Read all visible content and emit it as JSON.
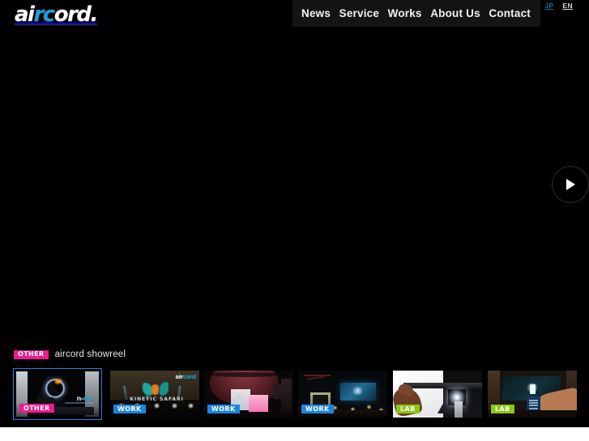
{
  "site": {
    "logo_text_a": "ai",
    "logo_text_b": "rc",
    "logo_text_c": "ord",
    "logo_dot": "."
  },
  "nav": {
    "items": [
      {
        "label": "News"
      },
      {
        "label": "Service"
      },
      {
        "label": "Works"
      },
      {
        "label": "About Us"
      },
      {
        "label": "Contact"
      }
    ]
  },
  "lang": {
    "jp": "JP",
    "en": "EN",
    "jp_color": "#1a6e9e",
    "en_color": "#d8d8d8"
  },
  "hero": {
    "next_button_label": "▶",
    "caption_badge": "OTHER",
    "caption_title": "aircord showreel"
  },
  "colors": {
    "accent_blue": "#1f9fd8",
    "badge_other": "#ec1b8e",
    "badge_work": "#1a86e0",
    "badge_lab": "#8cc713",
    "background": "#000000",
    "footer": "#ffffff"
  },
  "thumbnails": [
    {
      "badge": "OTHER",
      "category": "other",
      "active": true
    },
    {
      "badge": "WORK",
      "category": "work",
      "active": false
    },
    {
      "badge": "WORK",
      "category": "work",
      "active": false
    },
    {
      "badge": "WORK",
      "category": "work",
      "active": false
    },
    {
      "badge": "LAB",
      "category": "lab",
      "active": false
    },
    {
      "badge": "LAB",
      "category": "lab",
      "active": false
    }
  ],
  "thumb_art": {
    "t1_mark_a": "n-",
    "t1_mark_b": "od",
    "t2_caption": "KINETIC SAFARI",
    "t2_logo_a": "air",
    "t2_logo_b": "cord"
  }
}
